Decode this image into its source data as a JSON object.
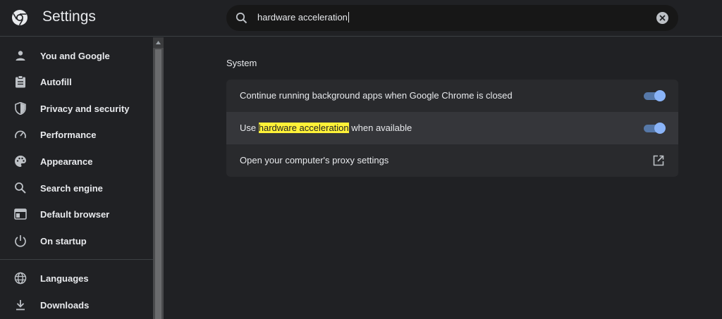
{
  "header": {
    "app_title": "Settings",
    "search_value": "hardware acceleration"
  },
  "sidebar": {
    "items": [
      {
        "label": "You and Google",
        "icon": "person-icon"
      },
      {
        "label": "Autofill",
        "icon": "clipboard-icon"
      },
      {
        "label": "Privacy and security",
        "icon": "shield-icon"
      },
      {
        "label": "Performance",
        "icon": "speedometer-icon"
      },
      {
        "label": "Appearance",
        "icon": "palette-icon"
      },
      {
        "label": "Search engine",
        "icon": "search-icon"
      },
      {
        "label": "Default browser",
        "icon": "browser-icon"
      },
      {
        "label": "On startup",
        "icon": "power-icon"
      },
      {
        "label": "Languages",
        "icon": "globe-icon"
      },
      {
        "label": "Downloads",
        "icon": "download-icon"
      }
    ]
  },
  "main": {
    "section_title": "System",
    "rows": [
      {
        "label": "Continue running background apps when Google Chrome is closed",
        "toggle": true
      },
      {
        "label_before": "Use ",
        "label_highlight": "hardware acceleration",
        "label_after": " when available",
        "toggle": true
      },
      {
        "label": "Open your computer's proxy settings",
        "control": "open-in-new-icon"
      }
    ]
  },
  "colors": {
    "background": "#202124",
    "card": "#292a2d",
    "accent": "#8ab4f8",
    "highlight": "#fff238"
  }
}
